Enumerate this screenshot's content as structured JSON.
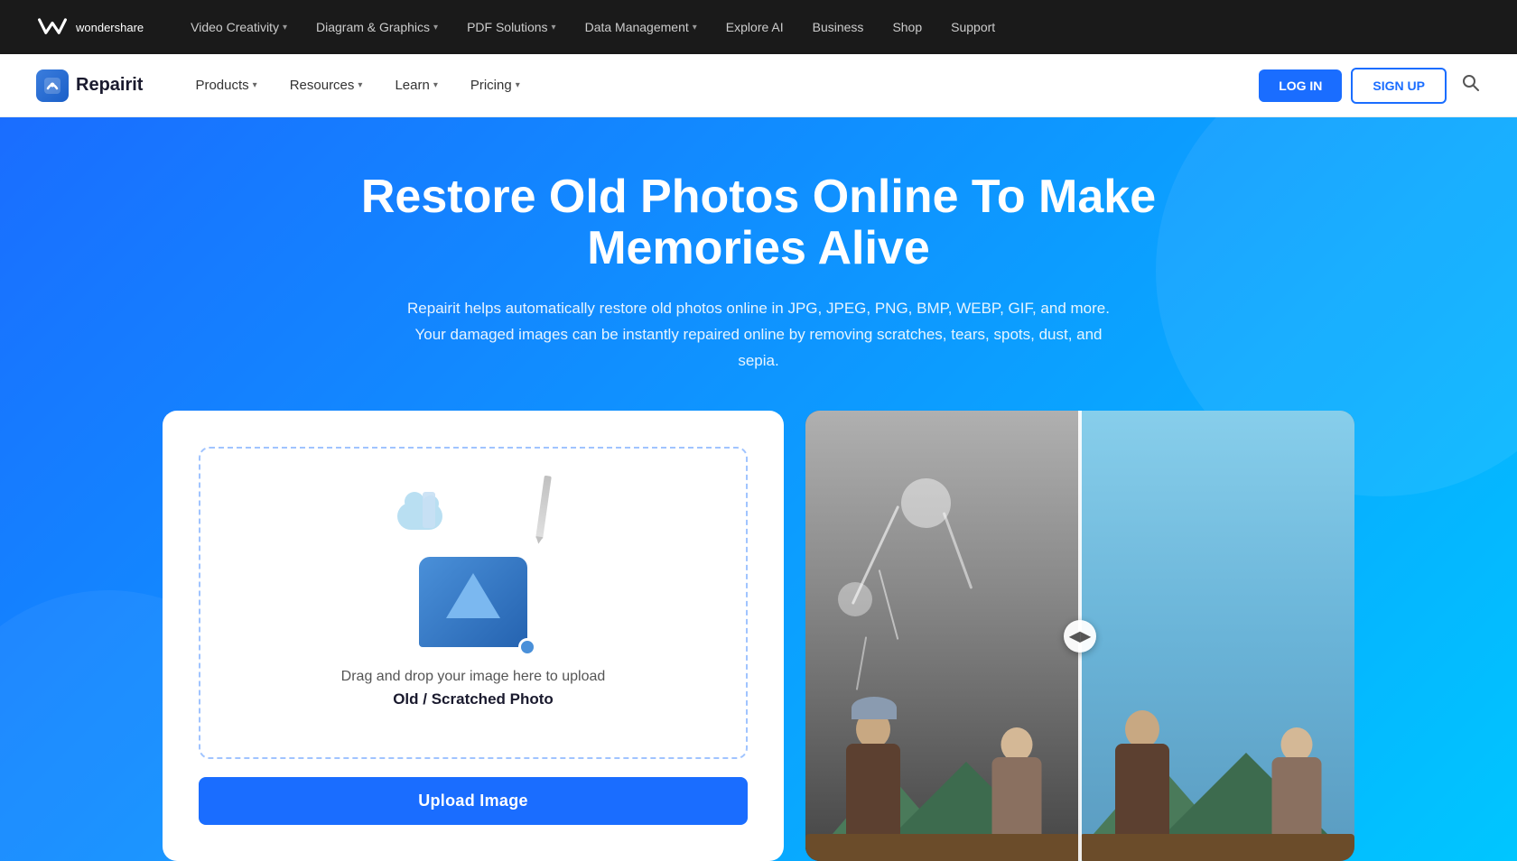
{
  "top_nav": {
    "logo_text": "wondershare",
    "items": [
      {
        "label": "Video Creativity",
        "has_dropdown": true
      },
      {
        "label": "Diagram & Graphics",
        "has_dropdown": true
      },
      {
        "label": "PDF Solutions",
        "has_dropdown": true
      },
      {
        "label": "Data Management",
        "has_dropdown": true
      },
      {
        "label": "Explore AI",
        "has_dropdown": false
      },
      {
        "label": "Business",
        "has_dropdown": false
      },
      {
        "label": "Shop",
        "has_dropdown": false
      },
      {
        "label": "Support",
        "has_dropdown": false
      }
    ]
  },
  "secondary_nav": {
    "brand_name": "Repairit",
    "nav_items": [
      {
        "label": "Products",
        "has_dropdown": true
      },
      {
        "label": "Resources",
        "has_dropdown": true
      },
      {
        "label": "Learn",
        "has_dropdown": true
      },
      {
        "label": "Pricing",
        "has_dropdown": true
      }
    ],
    "login_label": "LOG IN",
    "signup_label": "SIGN UP"
  },
  "hero": {
    "title": "Restore Old Photos Online To Make Memories Alive",
    "subtitle_line1": "Repairit helps automatically restore old photos online in JPG, JPEG, PNG, BMP, WEBP, GIF, and more.",
    "subtitle_line2": "Your damaged images can be instantly repaired online by removing scratches, tears, spots, dust, and sepia."
  },
  "upload_panel": {
    "drag_text": "Drag and drop your image here to upload",
    "type_label": "Old / Scratched Photo",
    "upload_button_label": "Upload Image"
  },
  "preview_panel": {
    "slider_icon": "◀▶"
  }
}
